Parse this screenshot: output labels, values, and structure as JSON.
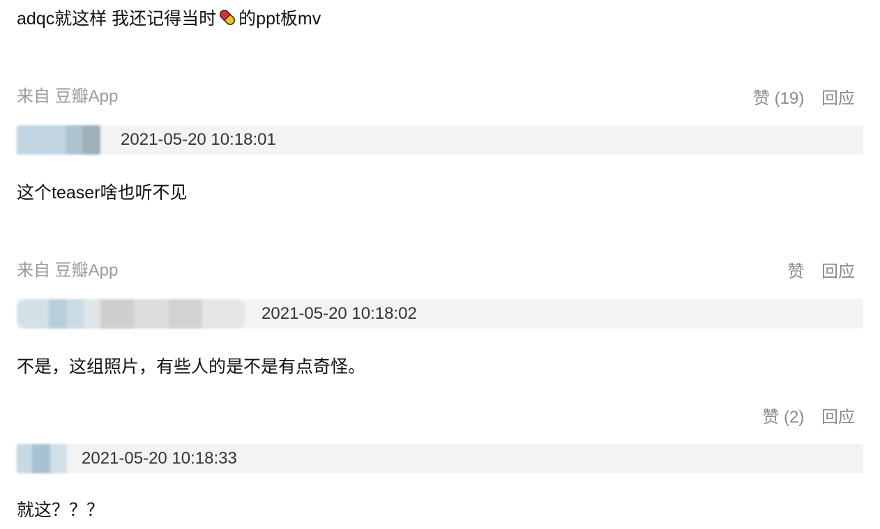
{
  "comments": [
    {
      "text_before_icon": "adqc就这样 我还记得当时",
      "icon": "pill-icon",
      "text_after_icon": "的ppt板mv",
      "source": "来自 豆瓣App",
      "like_label": "赞 (19)",
      "reply_label": "回应"
    },
    {
      "timestamp": "2021-05-20 10:18:01",
      "text": "这个teaser啥也听不见",
      "source": "来自 豆瓣App",
      "like_label": "赞",
      "reply_label": "回应"
    },
    {
      "timestamp": "2021-05-20 10:18:02",
      "text": "不是，这组照片，有些人的是不是有点奇怪。",
      "like_label": "赞 (2)",
      "reply_label": "回应"
    },
    {
      "timestamp": "2021-05-20 10:18:33",
      "text": "就这？？？"
    }
  ],
  "colors": {
    "meta_bar": "#f2f3f3",
    "secondary_text": "#9a9a9a",
    "blur_blue": "#b9cfdc",
    "blur_gray": "#cfcfcf"
  }
}
